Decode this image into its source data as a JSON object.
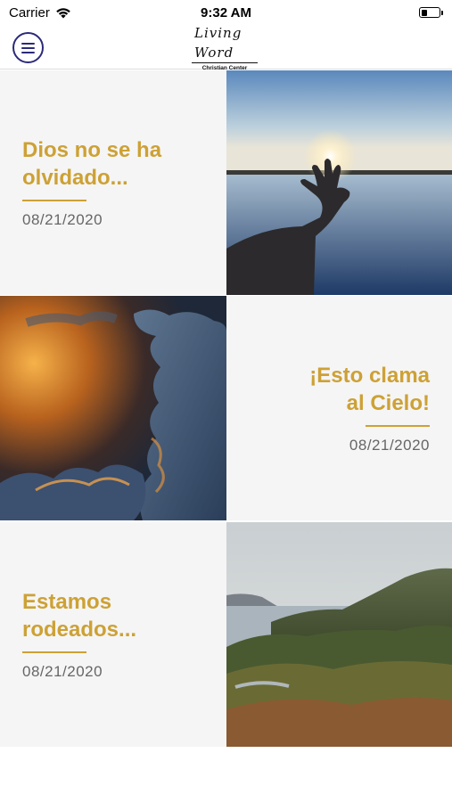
{
  "status_bar": {
    "carrier": "Carrier",
    "time": "9:32 AM"
  },
  "header": {
    "logo_script": "Living Word",
    "logo_sub": "Christian Center"
  },
  "posts": [
    {
      "title_line1": "Dios no se ha",
      "title_line2": "olvidado...",
      "date": "08/21/2020",
      "image": "hand-sunset-lake"
    },
    {
      "title_line1": "¡Esto clama",
      "title_line2": "al Cielo!",
      "date": "08/21/2020",
      "image": "sunlit-clouds"
    },
    {
      "title_line1": "Estamos",
      "title_line2": "rodeados...",
      "date": "08/21/2020",
      "image": "coastal-hills"
    }
  ],
  "colors": {
    "accent": "#cda135",
    "menu": "#2b2a7a",
    "tile_bg": "#f5f5f5",
    "date": "#666666"
  }
}
